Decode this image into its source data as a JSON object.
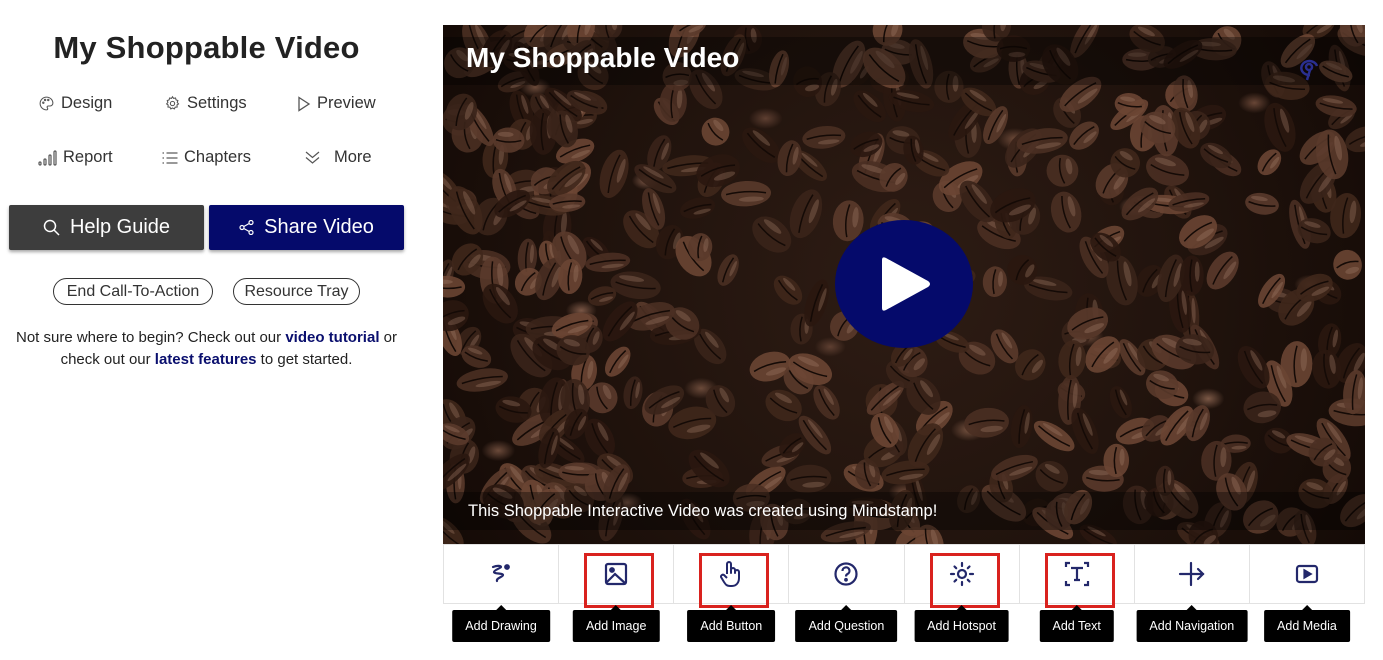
{
  "left": {
    "title": "My Shoppable Video",
    "nav": [
      {
        "label": "Design",
        "icon": "palette-icon"
      },
      {
        "label": "Settings",
        "icon": "gear-icon"
      },
      {
        "label": "Preview",
        "icon": "play-outline-icon"
      },
      {
        "label": "Report",
        "icon": "bar-chart-icon"
      },
      {
        "label": "Chapters",
        "icon": "list-icon"
      },
      {
        "label": "More",
        "icon": "double-chevron-down-icon"
      }
    ],
    "help_button": "Help Guide",
    "share_button": "Share Video",
    "end_cta": "End Call-To-Action",
    "resource_tray": "Resource Tray",
    "help_text": {
      "part1": "Not sure where to begin? Check out our ",
      "link1": "video tutorial",
      "part2": " or check out our ",
      "link2": "latest features",
      "part3": " to get started."
    }
  },
  "video": {
    "title": "My Shoppable Video",
    "caption": "This Shoppable Interactive Video was created using Mindstamp!"
  },
  "toolbar": {
    "tools": [
      {
        "label": "Add Drawing",
        "icon": "drawing-icon",
        "highlighted": false
      },
      {
        "label": "Add Image",
        "icon": "image-icon",
        "highlighted": true
      },
      {
        "label": "Add Button",
        "icon": "pointer-hand-icon",
        "highlighted": true
      },
      {
        "label": "Add Question",
        "icon": "question-icon",
        "highlighted": false
      },
      {
        "label": "Add Hotspot",
        "icon": "hotspot-icon",
        "highlighted": true
      },
      {
        "label": "Add Text",
        "icon": "text-icon",
        "highlighted": true
      },
      {
        "label": "Add Navigation",
        "icon": "navigation-icon",
        "highlighted": false
      },
      {
        "label": "Add Media",
        "icon": "media-icon",
        "highlighted": false
      }
    ]
  },
  "colors": {
    "brand_navy": "#050a6b",
    "highlight_red": "#d9221e",
    "help_button_bg": "#3d3d3d"
  }
}
